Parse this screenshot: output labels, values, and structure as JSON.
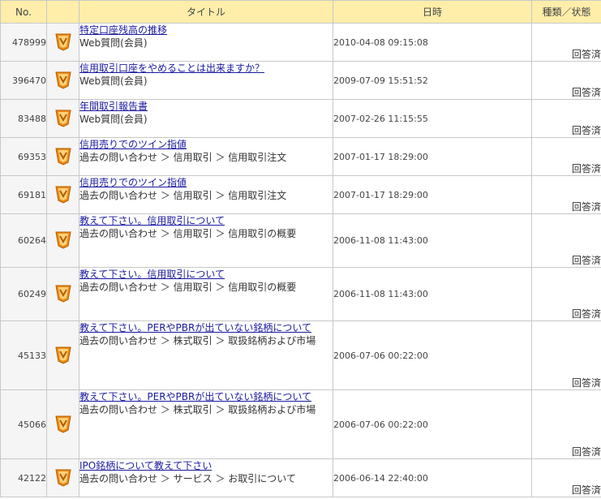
{
  "header": {
    "no": "No.",
    "title": "タイトル",
    "date": "日時",
    "status": "種類／状態"
  },
  "rows": [
    {
      "no": "478999",
      "title": "特定口座残高の推移",
      "category": "Web質問(会員)",
      "date": "2010-04-08 09:15:08",
      "status": "回答済"
    },
    {
      "no": "396470",
      "title": "信用取引口座をやめることは出来ますか？",
      "category": "Web質問(会員)",
      "date": "2009-07-09 15:51:52",
      "status": "回答済"
    },
    {
      "no": "83488",
      "title": "年間取引報告書",
      "category": "Web質問(会員)",
      "date": "2007-02-26 11:15:55",
      "status": "回答済"
    },
    {
      "no": "69353",
      "title": "信用売りでのツイン指値",
      "category": "過去の問い合わせ ＞ 信用取引 ＞ 信用取引注文",
      "date": "2007-01-17 18:29:00",
      "status": "回答済"
    },
    {
      "no": "69181",
      "title": "信用売りでのツイン指値",
      "category": "過去の問い合わせ ＞ 信用取引 ＞ 信用取引注文",
      "date": "2007-01-17 18:29:00",
      "status": "回答済"
    },
    {
      "no": "60264",
      "title": "教えて下さい。信用取引について",
      "category": "過去の問い合わせ ＞ 信用取引 ＞ 信用取引の概要",
      "date": "2006-11-08 11:43:00",
      "status": "回答済"
    },
    {
      "no": "60249",
      "title": "教えて下さい。信用取引について",
      "category": "過去の問い合わせ ＞ 信用取引 ＞ 信用取引の概要",
      "date": "2006-11-08 11:43:00",
      "status": "回答済"
    },
    {
      "no": "45133",
      "title": "教えて下さい。PERやPBRが出ていない銘柄について",
      "category": "過去の問い合わせ ＞ 株式取引 ＞ 取扱銘柄および市場",
      "date": "2006-07-06 00:22:00",
      "status": "回答済"
    },
    {
      "no": "45066",
      "title": "教えて下さい。PERやPBRが出ていない銘柄について",
      "category": "過去の問い合わせ ＞ 株式取引 ＞ 取扱銘柄および市場",
      "date": "2006-07-06 00:22:00",
      "status": "回答済"
    },
    {
      "no": "42122",
      "title": "IPO銘柄について教えて下さい",
      "category": "過去の問い合わせ ＞ サービス ＞ お取引について",
      "date": "2006-06-14 22:40:00",
      "status": "回答済"
    }
  ],
  "colors": {
    "header_bg": "#ffeeaa",
    "icon_orange": "#f08a12",
    "link": "#1a1aa0"
  },
  "icon": "answered-badge-icon"
}
